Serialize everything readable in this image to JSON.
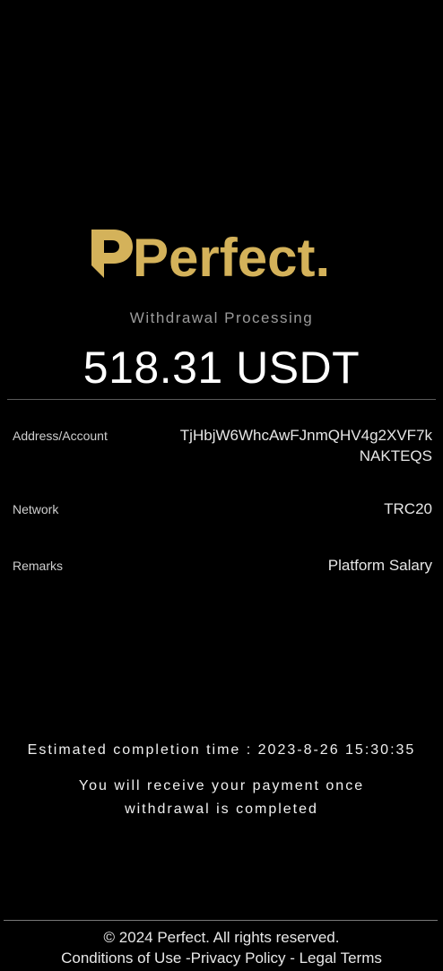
{
  "brand": {
    "name": "Perfect.",
    "logo_color": "#d4b25a"
  },
  "transaction": {
    "status": "Withdrawal Processing",
    "amount": "518.31 USDT"
  },
  "details": {
    "address_label": "Address/Account",
    "address_value": "TjHbjW6WhcAwFJnmQHV4g2XVF7kNAKTEQS",
    "network_label": "Network",
    "network_value": "TRC20",
    "remarks_label": "Remarks",
    "remarks_value": "Platform Salary"
  },
  "info": {
    "eta": "Estimated completion time : 2023-8-26 15:30:35",
    "note": "You will receive your payment once withdrawal is completed"
  },
  "footer": {
    "copyright": "© 2024 Perfect. All rights reserved.",
    "conditions": "Conditions of Use",
    "sep1": " -",
    "privacy": "Privacy Policy",
    "sep2": " - ",
    "legal": "Legal Terms"
  }
}
